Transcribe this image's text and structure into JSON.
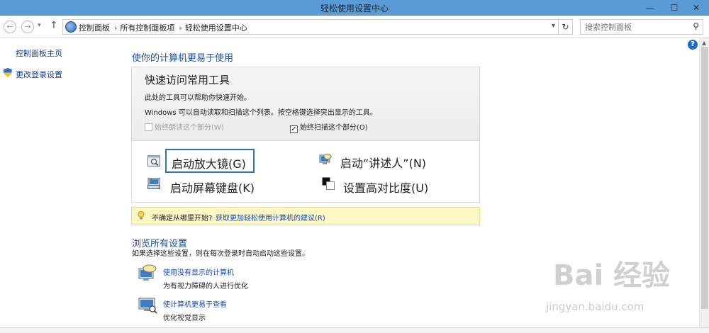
{
  "window": {
    "title": "轻松使用设置中心",
    "minimize": "—",
    "maximize": "☐",
    "close": "✕"
  },
  "nav": {
    "back": "←",
    "forward": "→",
    "up": "↑",
    "breadcrumbs": [
      "控制面板",
      "所有控制面板项",
      "轻松使用设置中心"
    ],
    "separator": "›",
    "search_placeholder": "搜索控制面板"
  },
  "sidebar": {
    "home": "控制面板主页",
    "change_login": "更改登录设置"
  },
  "main": {
    "heading": "使你的计算机更易于使用",
    "quick_access": {
      "title": "快速访问常用工具",
      "line1": "此处的工具可以帮助你快速开始。",
      "line2": "Windows 可以自动读取和扫描这个列表。按空格键选择突出显示的工具。",
      "always_read": "始终朗读这个部分(W)",
      "always_scan": "始终扫描这个部分(O)",
      "always_read_checked": false,
      "always_scan_checked": true
    },
    "tools": {
      "magnifier": "启动放大镜(G)",
      "narrator": "启动“讲述人”(N)",
      "osk": "启动屏幕键盘(K)",
      "high_contrast": "设置高对比度(U)"
    },
    "hint": {
      "text": "不确定从哪里开始?",
      "link": "获取更加轻松使用计算机的建议(R)"
    },
    "browse": {
      "heading": "浏览所有设置",
      "subtitle": "如果选择这些设置，则在每次登录时自动启动这些设置。",
      "items": [
        {
          "link": "使用没有显示的计算机",
          "desc": "为有视力障碍的人进行优化"
        },
        {
          "link": "使计算机更易于查看",
          "desc": "优化视觉显示"
        }
      ]
    }
  },
  "watermark": {
    "logo": "Bai 经验",
    "url": "jingyan.baidu.com"
  }
}
